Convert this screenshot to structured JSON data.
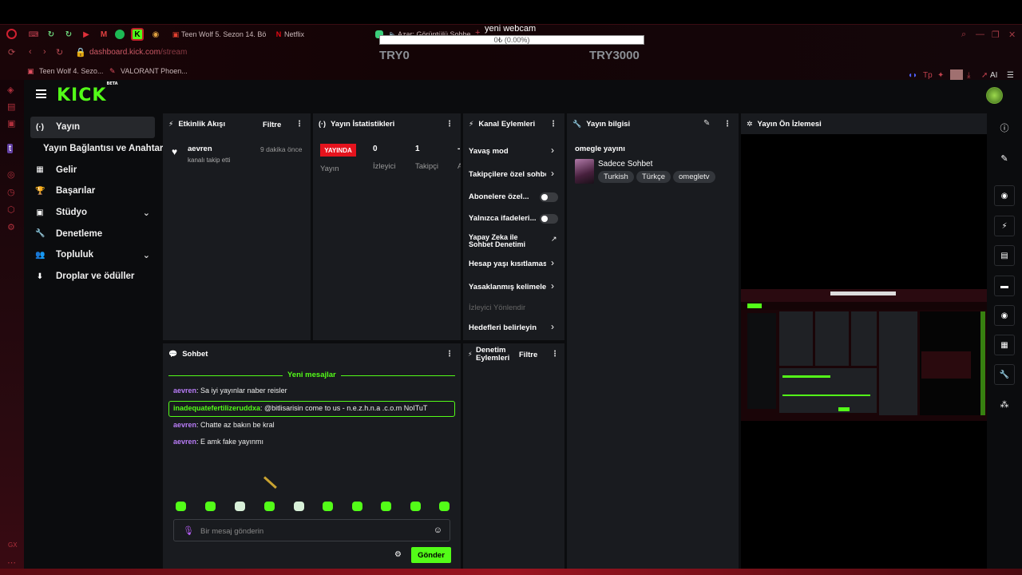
{
  "browser": {
    "tabs": [
      {
        "label": "Teen Wolf 5. Sezon 14. Bö"
      },
      {
        "label": "Netflix"
      },
      {
        "label": "Azar: Görüntülü Sohbe"
      }
    ],
    "url_domain": "dashboard.kick.com",
    "url_path": "/stream",
    "bookmarks": [
      {
        "label": "Teen Wolf 4. Sezo..."
      },
      {
        "label": "VALORANT Phoen..."
      }
    ],
    "ext_ai": "AI"
  },
  "overlay": {
    "title": "yeni webcam",
    "progress_text": "0₺ (0.00%)",
    "progress_fraction": 0,
    "min_label": "TRY0",
    "max_label": "TRY3000"
  },
  "kick": {
    "logo": "KICK",
    "logo_badge": "BETA",
    "nav": [
      {
        "label": "Yayın",
        "icon": "broadcast-icon",
        "active": true
      },
      {
        "label": "Yayın Bağlantısı ve Anahtarı",
        "icon": ""
      },
      {
        "label": "Gelir",
        "icon": "chart-icon"
      },
      {
        "label": "Başarılar",
        "icon": "trophy-icon"
      },
      {
        "label": "Stüdyo",
        "icon": "studio-icon",
        "expandable": true
      },
      {
        "label": "Denetleme",
        "icon": "wrench-icon"
      },
      {
        "label": "Topluluk",
        "icon": "community-icon",
        "expandable": true
      },
      {
        "label": "Droplar ve ödüller",
        "icon": "drops-icon"
      }
    ],
    "activity": {
      "title": "Etkinlik Akışı",
      "filter": "Filtre",
      "item": {
        "user": "aevren",
        "text": "kanalı takip etti",
        "time": "9 dakika önce"
      }
    },
    "stats": {
      "title": "Yayın İstatistikleri",
      "live": "YAYINDA",
      "live_label": "Yayın",
      "viewers_value": "0",
      "viewers_label": "İzleyici",
      "followers_value": "1",
      "followers_label": "Takipçi",
      "extra_value": "-",
      "extra_label": "A"
    },
    "channel_actions": {
      "title": "Kanal Eylemleri",
      "items": [
        {
          "label": "Yavaş mod",
          "kind": "chevron"
        },
        {
          "label": "Takipçilere özel sohbe",
          "kind": "chevron"
        },
        {
          "label": "Abonelere özel...",
          "kind": "toggle",
          "on": false
        },
        {
          "label": "Yalnızca ifadeleri...",
          "kind": "toggle",
          "on": false
        },
        {
          "label": "Yapay Zeka ile",
          "label2": "Sohbet Denetimi",
          "kind": "external"
        },
        {
          "label": "Hesap yaşı kısıtlamas",
          "kind": "chevron"
        },
        {
          "label": "Yasaklanmış kelimeler",
          "kind": "chevron"
        },
        {
          "label": "İzleyici Yönlendir",
          "kind": "disabled"
        },
        {
          "label": "Hedefleri belirleyin",
          "kind": "chevron"
        }
      ]
    },
    "mod_actions": {
      "title_line1": "Denetim",
      "title_line2": "Eylemleri",
      "filter": "Filtre"
    },
    "stream_info": {
      "title": "Yayın bilgisi",
      "stream_title": "omegle yayını",
      "category": "Sadece Sohbet",
      "tags": [
        "Turkish",
        "Türkçe",
        "omegletv"
      ]
    },
    "preview": {
      "title": "Yayın Ön İzlemesi"
    },
    "chat": {
      "title": "Sohbet",
      "new_messages": "Yeni mesajlar",
      "messages": [
        {
          "user": "aevren",
          "color": "#b87cf7",
          "text": ": Sa iyi yayınlar naber reisler"
        },
        {
          "user": "inadequatefertilizeruddxa",
          "color": "#53fc18",
          "text": ": @bitlisarisin come to us - n.e.z.h.n.a .c.o.m NoITuT",
          "highlight": true
        },
        {
          "user": "aevren",
          "color": "#b87cf7",
          "text": ": Chatte az bakın be kral"
        },
        {
          "user": "aevren",
          "color": "#b87cf7",
          "text": ": E amk fake yayınmı"
        }
      ],
      "input_placeholder": "Bir mesaj gönderin",
      "send_label": "Gönder"
    }
  },
  "colors": {
    "accent": "#53fc18",
    "live": "#e5131d",
    "panel": "#191b1f",
    "browser": "#1a0508"
  }
}
